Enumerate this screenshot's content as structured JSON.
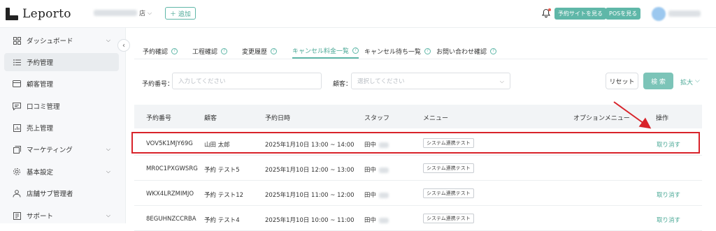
{
  "header": {
    "logo_text": "Leporto",
    "store_suffix": "店",
    "add_button": "＋ 追加",
    "reservation_site_button": "予約サイトを見る",
    "pos_button": "POSを見る"
  },
  "sidebar": {
    "items": [
      {
        "label": "ダッシュボード",
        "icon": "dashboard-icon",
        "chevron": true
      },
      {
        "label": "予約管理",
        "icon": "list-icon",
        "active": true
      },
      {
        "label": "顧客管理",
        "icon": "card-icon"
      },
      {
        "label": "口コミ管理",
        "icon": "comment-icon"
      },
      {
        "label": "売上管理",
        "icon": "chart-icon"
      },
      {
        "label": "マーケティング",
        "icon": "marketing-icon",
        "chevron": true
      },
      {
        "label": "基本設定",
        "icon": "gear-icon",
        "chevron": true
      },
      {
        "label": "店舗サブ管理者",
        "icon": "user-icon"
      },
      {
        "label": "サポート",
        "icon": "support-icon",
        "chevron": true
      }
    ]
  },
  "tabs": [
    {
      "label": "予約確認"
    },
    {
      "label": "工程確認"
    },
    {
      "label": "変更履歴"
    },
    {
      "label": "キャンセル料金一覧",
      "active": true
    },
    {
      "label": "キャンセル待ち一覧"
    },
    {
      "label": "お問い合わせ確認"
    }
  ],
  "search": {
    "reservation_label": "予約番号：",
    "reservation_placeholder": "入力してください",
    "customer_label": "顧客：",
    "customer_placeholder": "選択してください",
    "reset_label": "リセット",
    "search_label": "検 索",
    "expand_label": "拡大"
  },
  "table": {
    "headers": [
      "予約番号",
      "顧客",
      "予約日時",
      "スタッフ",
      "メニュー",
      "オプションメニュー",
      "操作"
    ],
    "rows": [
      {
        "id": "VOV5K1MJY69G",
        "customer": "山田 太郎",
        "datetime": "2025年1月10日 13:00 ~ 14:00",
        "staff": "田中",
        "menu": "システム連携テスト",
        "action": "取り消す"
      },
      {
        "id": "MR0C1PXGWSRG",
        "customer": "予約 テスト5",
        "datetime": "2025年1月10日 12:00 ~ 13:00",
        "staff": "田中",
        "menu": "システム連携テスト",
        "action": ""
      },
      {
        "id": "WKX4LRZMIMJO",
        "customer": "予約 テスト12",
        "datetime": "2025年1月10日 11:00 ~ 12:00",
        "staff": "田中",
        "menu": "システム連携テスト",
        "action": "取り消す"
      },
      {
        "id": "8EGUHNZCCRBA",
        "customer": "予約 テスト4",
        "datetime": "2025年1月10日 10:00 ~ 11:00",
        "staff": "田中",
        "menu": "システム連携テスト",
        "action": "取り消す"
      }
    ]
  },
  "colors": {
    "accent": "#5fb7a8",
    "highlight": "#d8232a",
    "notification": "#e85a4f"
  }
}
